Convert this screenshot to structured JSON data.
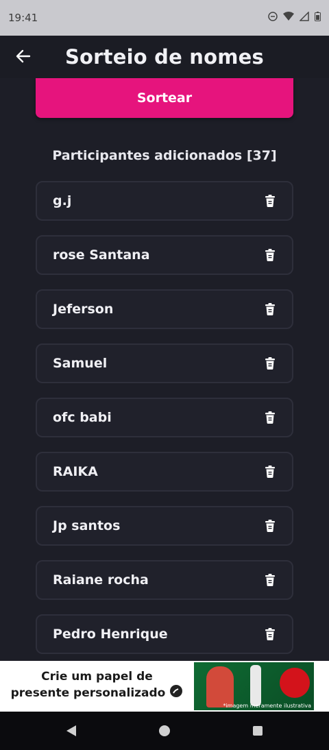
{
  "status_bar": {
    "time": "19:41",
    "icons": [
      "do-not-disturb-icon",
      "wifi-icon",
      "signal-icon",
      "battery-icon"
    ]
  },
  "app_bar": {
    "title": "Sorteio de nomes",
    "back_icon": "arrow-left-icon"
  },
  "main": {
    "draw_button_label": "Sortear",
    "participants_title": "Participantes adicionados [37]",
    "participants": [
      {
        "name": "g.j"
      },
      {
        "name": "rose Santana"
      },
      {
        "name": "Jeferson"
      },
      {
        "name": "Samuel"
      },
      {
        "name": "ofc babi"
      },
      {
        "name": "RAIKA"
      },
      {
        "name": "Jp santos"
      },
      {
        "name": "Raiane rocha"
      },
      {
        "name": "Pedro Henrique"
      }
    ]
  },
  "ad": {
    "line1": "Crie um papel de",
    "line2": "presente personalizado",
    "caption": "*imagem meramente ilustrativa"
  },
  "colors": {
    "accent": "#e6147d",
    "background": "#1b1c24",
    "card": "#20212b"
  }
}
